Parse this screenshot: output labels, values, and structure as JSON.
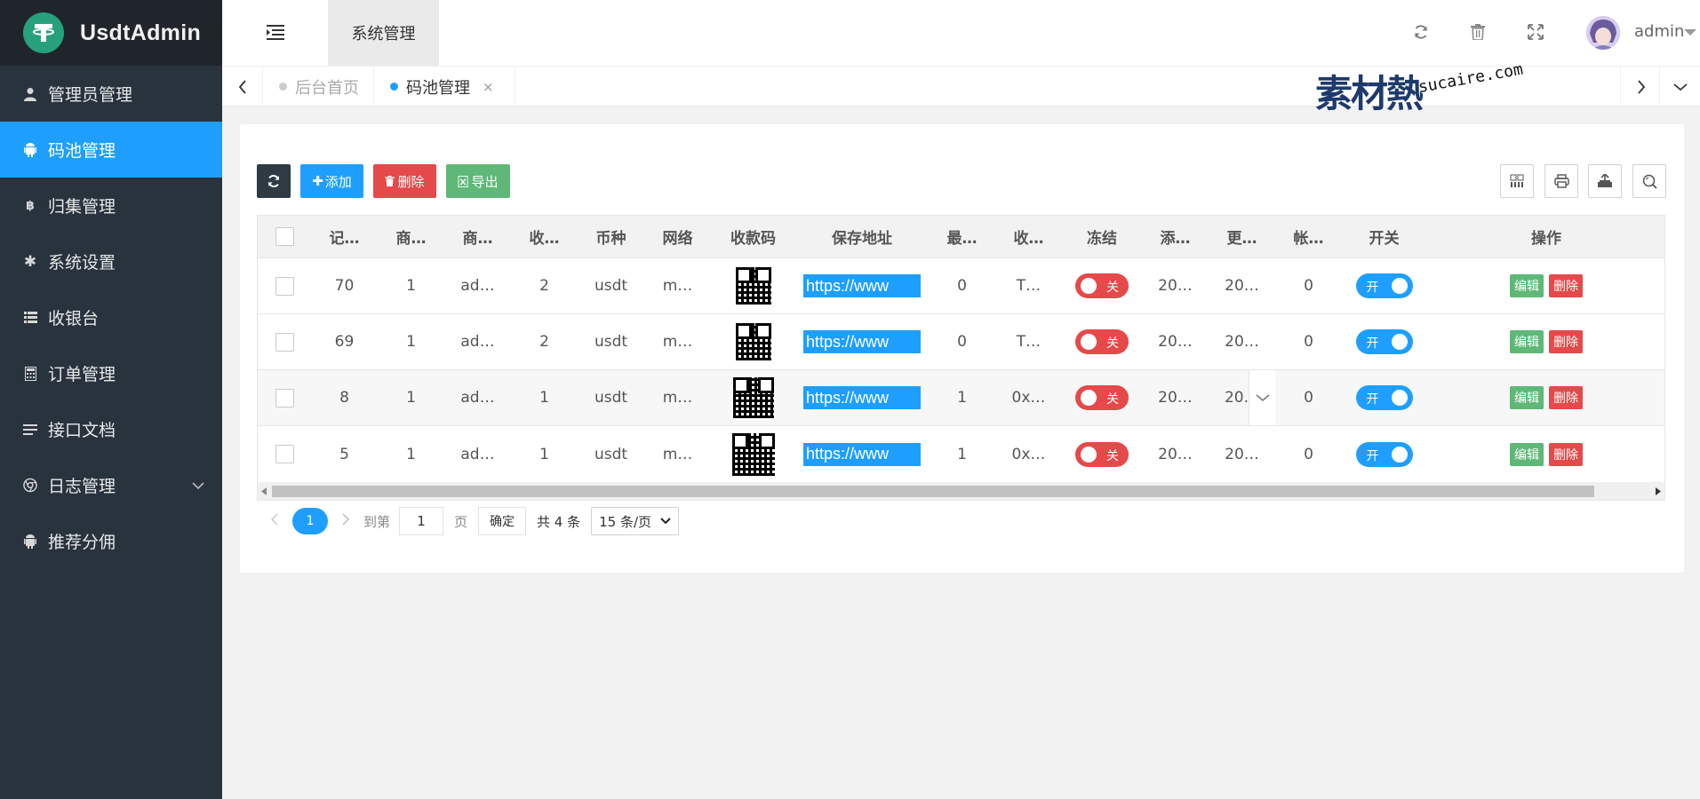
{
  "app": {
    "name": "UsdtAdmin",
    "logo_symbol": "T"
  },
  "sidebar": {
    "items": [
      {
        "label": "管理员管理",
        "icon": "user-icon"
      },
      {
        "label": "码池管理",
        "icon": "android-icon",
        "active": true
      },
      {
        "label": "归集管理",
        "icon": "bitcoin-icon"
      },
      {
        "label": "系统设置",
        "icon": "gear-icon"
      },
      {
        "label": "收银台",
        "icon": "list-icon"
      },
      {
        "label": "订单管理",
        "icon": "calculator-icon"
      },
      {
        "label": "接口文档",
        "icon": "text-icon"
      },
      {
        "label": "日志管理",
        "icon": "chrome-icon"
      },
      {
        "label": "推荐分佣",
        "icon": "android-icon"
      }
    ]
  },
  "header": {
    "tab": "系统管理",
    "user": "admin"
  },
  "tabs": [
    {
      "label": "后台首页",
      "active": false
    },
    {
      "label": "码池管理",
      "active": true,
      "close": "×"
    }
  ],
  "watermark": {
    "cn": "素材熱",
    "en": "sucaire.com"
  },
  "toolbar": {
    "add": "添加",
    "delete": "删除",
    "export": "导出"
  },
  "table": {
    "columns": [
      "记…",
      "商…",
      "商…",
      "收…",
      "币种",
      "网络",
      "收款码",
      "保存地址",
      "最…",
      "收…",
      "冻结",
      "添…",
      "更…",
      "帐…",
      "开关",
      "操作"
    ],
    "rows": [
      {
        "c1": "70",
        "c2": "1",
        "c3": "ad…",
        "c4": "2",
        "coin": "usdt",
        "net": "m…",
        "url": "https://www",
        "c9": "0",
        "c10": "T…",
        "freeze": "关",
        "c12": "20…",
        "c13": "20…",
        "c14": "0",
        "switch": "开"
      },
      {
        "c1": "69",
        "c2": "1",
        "c3": "ad…",
        "c4": "2",
        "coin": "usdt",
        "net": "m…",
        "url": "https://www",
        "c9": "0",
        "c10": "T…",
        "freeze": "关",
        "c12": "20…",
        "c13": "20…",
        "c14": "0",
        "switch": "开"
      },
      {
        "c1": "8",
        "c2": "1",
        "c3": "ad…",
        "c4": "1",
        "coin": "usdt",
        "net": "m…",
        "url": "https://www",
        "c9": "1",
        "c10": "0x…",
        "freeze": "关",
        "c12": "20…",
        "c13": "20.",
        "c14": "0",
        "switch": "开"
      },
      {
        "c1": "5",
        "c2": "1",
        "c3": "ad…",
        "c4": "1",
        "coin": "usdt",
        "net": "m…",
        "url": "https://www",
        "c9": "1",
        "c10": "0x…",
        "freeze": "关",
        "c12": "20…",
        "c13": "20…",
        "c14": "0",
        "switch": "开"
      }
    ],
    "edit_label": "编辑",
    "delete_label": "删除"
  },
  "pager": {
    "current": "1",
    "goto_label": "到第",
    "goto_value": "1",
    "page_unit": "页",
    "confirm": "确定",
    "total": "共 4 条",
    "per_page": "15 条/页"
  },
  "colors": {
    "sidebar_bg": "#28333e",
    "logo_bg": "#20252b",
    "active_blue": "#1e9fff",
    "danger": "#e5494a",
    "success": "#5fb878",
    "dark_btn": "#2f3a45"
  }
}
